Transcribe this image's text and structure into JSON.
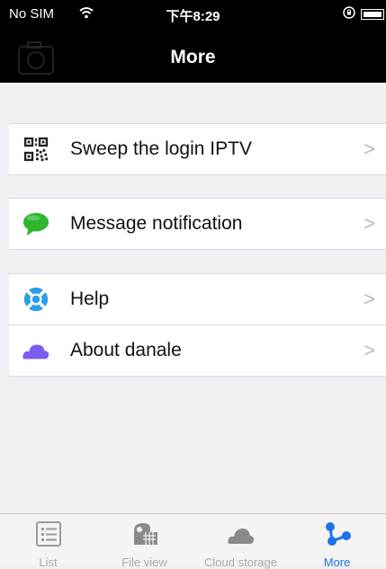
{
  "status_bar": {
    "carrier": "No SIM",
    "wifi_icon": "wifi-icon",
    "time": "下午8:29",
    "lock_icon": "orientation-lock-icon",
    "battery_icon": "battery-icon"
  },
  "nav": {
    "title": "More"
  },
  "menu": {
    "sweep_login": {
      "label": "Sweep the login IPTV",
      "icon": "qr-code-icon"
    },
    "message_notification": {
      "label": "Message notification",
      "icon": "chat-bubble-icon"
    },
    "help": {
      "label": "Help",
      "icon": "lifebuoy-icon"
    },
    "about": {
      "label": "About danale",
      "icon": "cloud-icon"
    },
    "chevron": ">"
  },
  "tabs": [
    {
      "label": "List",
      "icon": "list-icon",
      "active": false
    },
    {
      "label": "File view",
      "icon": "file-view-icon",
      "active": false
    },
    {
      "label": "Cloud storage",
      "icon": "cloud-storage-icon",
      "active": false
    },
    {
      "label": "More",
      "icon": "more-icon",
      "active": true
    }
  ],
  "colors": {
    "accent": "#1a73e8",
    "nav_bg": "#000000",
    "page_bg": "#efeff4",
    "chat_green": "#2fb52f",
    "help_blue": "#2a9ee8",
    "cloud_purple": "#7d5cf0"
  }
}
